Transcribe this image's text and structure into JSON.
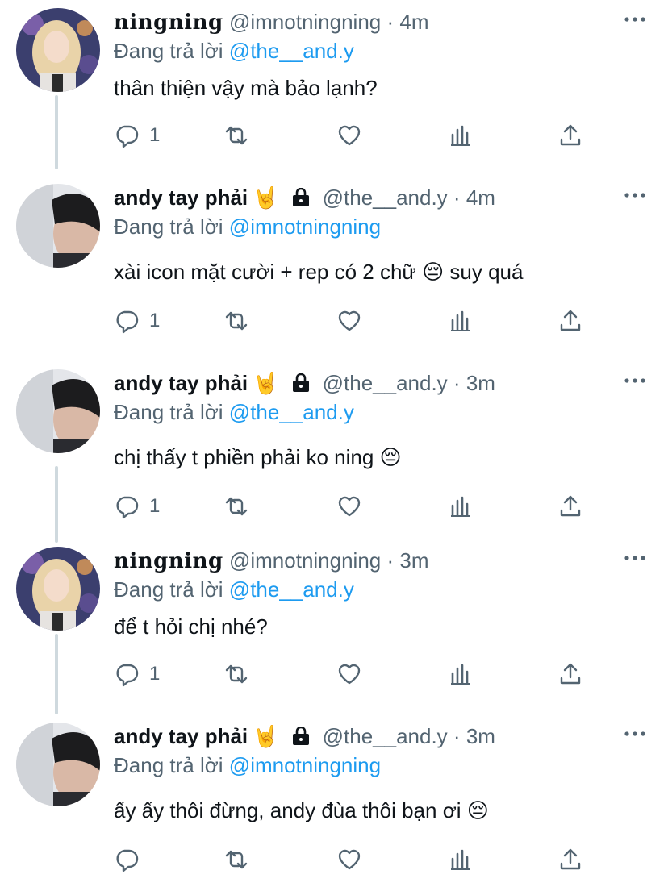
{
  "tweets": [
    {
      "name": "ningning",
      "handle": "@imnotningning",
      "time": "4m",
      "reply_label": "Đang trả lời",
      "reply_to": "@the__and.y",
      "text": "thân thiện vậy mà bảo lạnh?",
      "reply_count": "1"
    },
    {
      "name": "andy tay phải",
      "badge": "🤘",
      "handle": "@the__and.y",
      "time": "4m",
      "reply_label": "Đang trả lời",
      "reply_to": "@imnotningning",
      "text": "xài icon mặt cười + rep có 2 chữ 😔  suy quá",
      "reply_count": "1"
    },
    {
      "name": "andy tay phải",
      "badge": "🤘",
      "handle": "@the__and.y",
      "time": "3m",
      "reply_label": "Đang trả lời",
      "reply_to": "@the__and.y",
      "text": "chị thấy t phiền phải ko ning 😔",
      "reply_count": "1"
    },
    {
      "name": "ningning",
      "handle": "@imnotningning",
      "time": "3m",
      "reply_label": "Đang trả lời",
      "reply_to": "@the__and.y",
      "text": "để t hỏi chị nhé?",
      "reply_count": "1"
    },
    {
      "name": "andy tay phải",
      "badge": "🤘",
      "handle": "@the__and.y",
      "time": "3m",
      "reply_label": "Đang trả lời",
      "reply_to": "@imnotningning",
      "text": "ấy ấy thôi đừng, andy đùa thôi bạn ơi 😔",
      "reply_count": ""
    }
  ],
  "dot": "·",
  "icons": {
    "reply": "reply-icon",
    "retweet": "retweet-icon",
    "like": "heart-icon",
    "views": "views-icon",
    "share": "share-icon",
    "more": "more-icon",
    "lock": "lock-icon"
  },
  "colors": {
    "link": "#1d9bf0",
    "secondary": "#536471",
    "thread_line": "#cfd9de"
  }
}
